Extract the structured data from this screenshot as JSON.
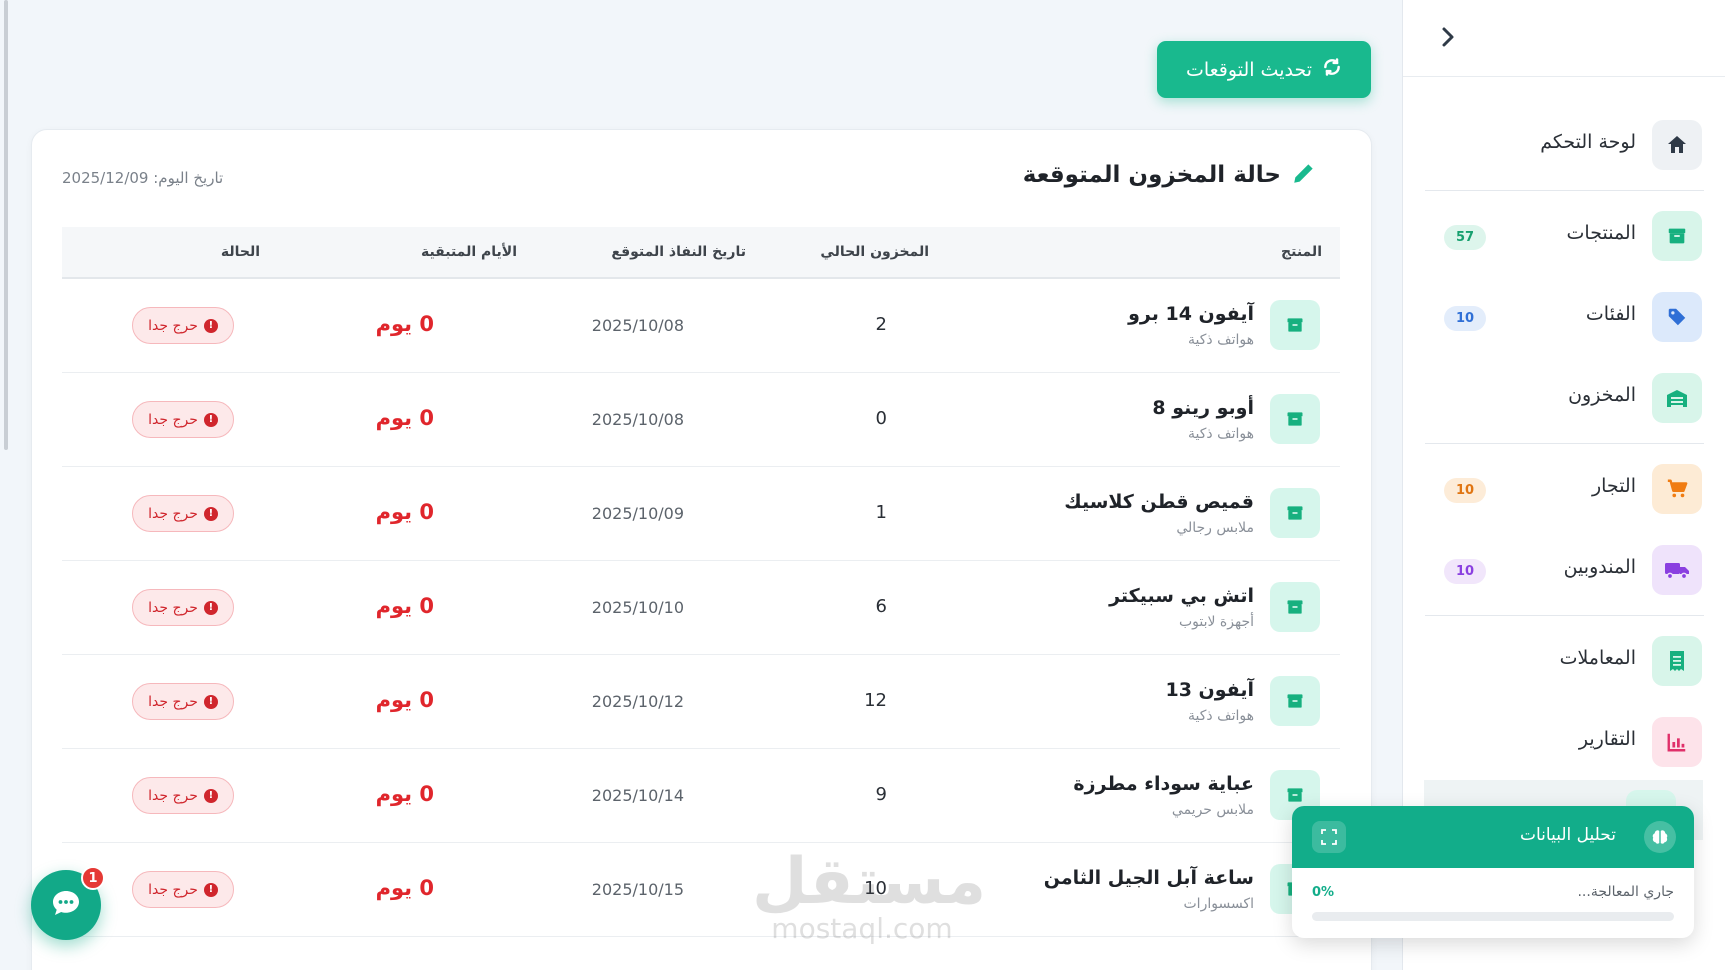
{
  "header": {
    "refresh_label": "تحديث التوقعات"
  },
  "card": {
    "title": "حالة المخزون المتوقعة",
    "date": "تاريخ اليوم: 2025/12/09"
  },
  "table": {
    "headers": {
      "product": "المنتج",
      "stock": "المخزون الحالي",
      "date": "تاريخ النفاذ المتوقع",
      "days": "الأيام المتبقية",
      "status": "الحالة"
    },
    "rows": [
      {
        "name": "آيفون 14 برو",
        "category": "هواتف ذكية",
        "stock": "2",
        "date": "2025/10/08",
        "days": "0 يوم",
        "status": "حرج جدا"
      },
      {
        "name": "أوبو رينو 8",
        "category": "هواتف ذكية",
        "stock": "0",
        "date": "2025/10/08",
        "days": "0 يوم",
        "status": "حرج جدا"
      },
      {
        "name": "قميص قطن كلاسيك",
        "category": "ملابس رجالي",
        "stock": "1",
        "date": "2025/10/09",
        "days": "0 يوم",
        "status": "حرج جدا"
      },
      {
        "name": "اتش بي سبيكتر",
        "category": "أجهزة لابتوب",
        "stock": "6",
        "date": "2025/10/10",
        "days": "0 يوم",
        "status": "حرج جدا"
      },
      {
        "name": "آيفون 13",
        "category": "هواتف ذكية",
        "stock": "12",
        "date": "2025/10/12",
        "days": "0 يوم",
        "status": "حرج جدا"
      },
      {
        "name": "عباية سوداء مطرزة",
        "category": "ملابس حريمي",
        "stock": "9",
        "date": "2025/10/14",
        "days": "0 يوم",
        "status": "حرج جدا"
      },
      {
        "name": "ساعة آبل الجيل الثامن",
        "category": "اكسسوارات",
        "stock": "10",
        "date": "2025/10/15",
        "days": "0 يوم",
        "status": "حرج جدا"
      }
    ]
  },
  "sidebar": {
    "items": [
      {
        "label": "لوحة التحكم",
        "icon": "home-icon",
        "badge": ""
      },
      {
        "label": "المنتجات",
        "icon": "box-icon",
        "badge": "57"
      },
      {
        "label": "الفئات",
        "icon": "tag-icon",
        "badge": "10"
      },
      {
        "label": "المخزون",
        "icon": "warehouse-icon",
        "badge": ""
      },
      {
        "label": "التجار",
        "icon": "cart-icon",
        "badge": "10"
      },
      {
        "label": "المندوبين",
        "icon": "truck-icon",
        "badge": "10"
      },
      {
        "label": "المعاملات",
        "icon": "receipt-icon",
        "badge": ""
      },
      {
        "label": "التقارير",
        "icon": "chart-icon",
        "badge": ""
      }
    ]
  },
  "analysis": {
    "title": "تحليل البيانات",
    "status": "جاري المعالجة...",
    "percent": "0%",
    "progress_fraction": 0
  },
  "chat": {
    "badge": "1"
  },
  "watermark": {
    "line1": "مستقل",
    "line2": "mostaql.com"
  },
  "colors": {
    "accent": "#19b98e",
    "danger": "#e0262c"
  }
}
